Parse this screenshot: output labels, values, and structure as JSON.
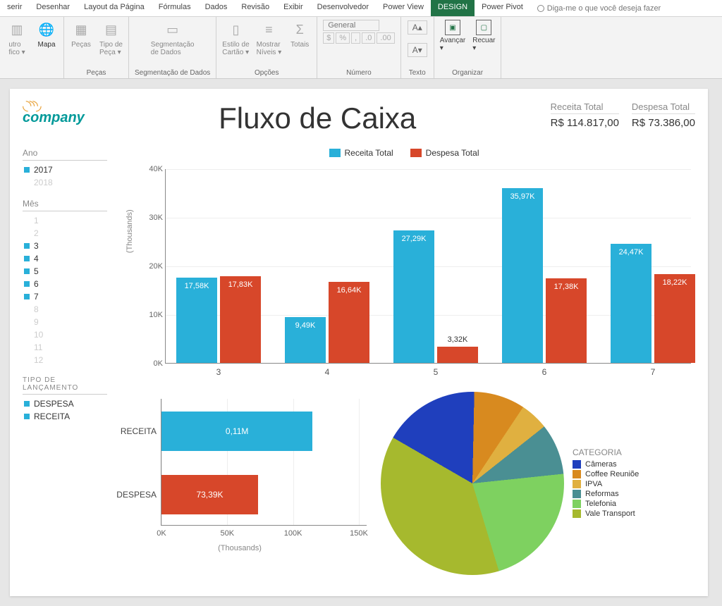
{
  "tabs": {
    "items": [
      "serir",
      "Desenhar",
      "Layout da Página",
      "Fórmulas",
      "Dados",
      "Revisão",
      "Exibir",
      "Desenvolvedor",
      "Power View",
      "DESIGN",
      "Power Pivot"
    ],
    "active_index": 9,
    "tell_me": "Diga-me o que você deseja fazer"
  },
  "ribbon": {
    "groups": [
      {
        "label": "",
        "buttons": [
          {
            "label": "utro",
            "sub": "fico ▾"
          },
          {
            "label": "Mapa",
            "sub": ""
          }
        ]
      },
      {
        "label": "Peças",
        "buttons": [
          {
            "label": "Peças"
          },
          {
            "label": "Tipo de",
            "sub": "Peça ▾"
          }
        ]
      },
      {
        "label": "Segmentação de Dados",
        "buttons": [
          {
            "label": "Segmentação",
            "sub": "de Dados"
          }
        ]
      },
      {
        "label": "Opções",
        "buttons": [
          {
            "label": "Estilo de",
            "sub": "Cartão ▾"
          },
          {
            "label": "Mostrar",
            "sub": "Níveis ▾"
          },
          {
            "label": "Totais"
          }
        ]
      }
    ],
    "number_group": {
      "format": "General",
      "symbols": [
        "%",
        "%",
        ",",
        ".0",
        ".00"
      ],
      "label": "Número"
    },
    "text_group": {
      "buttons": [
        "A▴",
        "A▾"
      ],
      "label": "Texto"
    },
    "arrange_group": {
      "buttons": [
        {
          "label": "Avançar",
          "sub": "▾"
        },
        {
          "label": "Recuar",
          "sub": "▾"
        }
      ],
      "label": "Organizar"
    }
  },
  "dashboard": {
    "logo_text": "company",
    "title": "Fluxo de Caixa",
    "totals": [
      {
        "label": "Receita Total",
        "value": "R$ 114.817,00"
      },
      {
        "label": "Despesa Total",
        "value": "R$ 73.386,00"
      }
    ]
  },
  "slicers": {
    "ano": {
      "title": "Ano",
      "items": [
        {
          "label": "2017",
          "sel": true
        },
        {
          "label": "2018",
          "sel": false
        }
      ]
    },
    "mes": {
      "title": "Mês",
      "items": [
        {
          "label": "1",
          "sel": false
        },
        {
          "label": "2",
          "sel": false
        },
        {
          "label": "3",
          "sel": true
        },
        {
          "label": "4",
          "sel": true
        },
        {
          "label": "5",
          "sel": true
        },
        {
          "label": "6",
          "sel": true
        },
        {
          "label": "7",
          "sel": true
        },
        {
          "label": "8",
          "sel": false
        },
        {
          "label": "9",
          "sel": false
        },
        {
          "label": "10",
          "sel": false
        },
        {
          "label": "11",
          "sel": false
        },
        {
          "label": "12",
          "sel": false
        }
      ]
    },
    "tipo": {
      "title": "TIPO DE LANÇAMENTO",
      "items": [
        {
          "label": "DESPESA",
          "sel": true
        },
        {
          "label": "RECEITA",
          "sel": true
        }
      ]
    }
  },
  "chart_data": [
    {
      "type": "bar",
      "title": "",
      "legend": [
        "Receita Total",
        "Despesa Total"
      ],
      "categories": [
        "3",
        "4",
        "5",
        "6",
        "7"
      ],
      "ylabel": "(Thousands)",
      "yticks": [
        "0K",
        "10K",
        "20K",
        "30K",
        "40K"
      ],
      "ylim": [
        0,
        40
      ],
      "series": [
        {
          "name": "Receita Total",
          "color": "#29b0d9",
          "values": [
            17.58,
            9.49,
            27.29,
            35.97,
            24.47
          ],
          "labels": [
            "17,58K",
            "9,49K",
            "27,29K",
            "35,97K",
            "24,47K"
          ]
        },
        {
          "name": "Despesa Total",
          "color": "#d7472a",
          "values": [
            17.83,
            16.64,
            3.32,
            17.38,
            18.22
          ],
          "labels": [
            "17,83K",
            "16,64K",
            "3,32K",
            "17,38K",
            "18,22K"
          ]
        }
      ]
    },
    {
      "type": "bar-horizontal",
      "categories": [
        "RECEITA",
        "DESPESA"
      ],
      "xlabel": "(Thousands)",
      "xticks": [
        "0K",
        "50K",
        "100K",
        "150K"
      ],
      "xlim": [
        0,
        150
      ],
      "series": [
        {
          "name": "RECEITA",
          "color": "#29b0d9",
          "value": 114.82,
          "label": "0,11M"
        },
        {
          "name": "DESPESA",
          "color": "#d7472a",
          "value": 73.39,
          "label": "73,39K"
        }
      ]
    },
    {
      "type": "pie",
      "legend_title": "CATEGORIA",
      "slices": [
        {
          "label": "Câmeras",
          "color": "#1f3fbd",
          "value": 17
        },
        {
          "label": "Coffee Reuniõe",
          "color": "#d88a1f",
          "value": 9
        },
        {
          "label": "IPVA",
          "color": "#e0b040",
          "value": 5
        },
        {
          "label": "Reformas",
          "color": "#4a8f93",
          "value": 9
        },
        {
          "label": "Telefonia",
          "color": "#7ed160",
          "value": 22
        },
        {
          "label": "Vale Transport",
          "color": "#a6b92e",
          "value": 38
        }
      ]
    }
  ]
}
